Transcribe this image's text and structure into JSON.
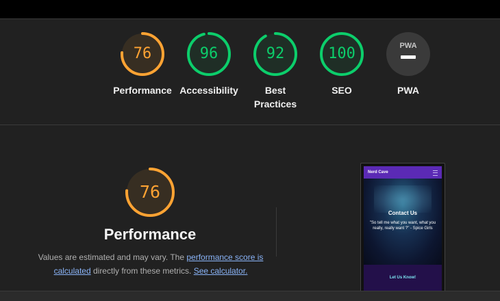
{
  "summary": {
    "gauges": [
      {
        "score": "76",
        "label": "Performance",
        "value": 76,
        "color": "#ffa333"
      },
      {
        "score": "96",
        "label": "Accessibility",
        "value": 96,
        "color": "#0cce6b"
      },
      {
        "score": "92",
        "label": "Best Practices",
        "label_line1": "Best",
        "label_line2": "Practices",
        "value": 92,
        "color": "#0cce6b"
      },
      {
        "score": "100",
        "label": "SEO",
        "value": 100,
        "color": "#0cce6b"
      },
      {
        "badge": "PWA",
        "label": "PWA"
      }
    ]
  },
  "performance": {
    "score": "76",
    "value": 76,
    "color": "#ffa333",
    "title": "Performance",
    "desc_prefix": "Values are estimated and may vary. The ",
    "link_score": "performance score is calculated",
    "desc_middle": " directly from these metrics. ",
    "link_calculator": "See calculator."
  },
  "screenshot": {
    "brand": "Nerd Cave",
    "hero_title": "Contact Us",
    "hero_quote": "\"So tell me what you want, what you really, really want ?\" - Spice Girls",
    "cta": "Let Us Know!"
  }
}
